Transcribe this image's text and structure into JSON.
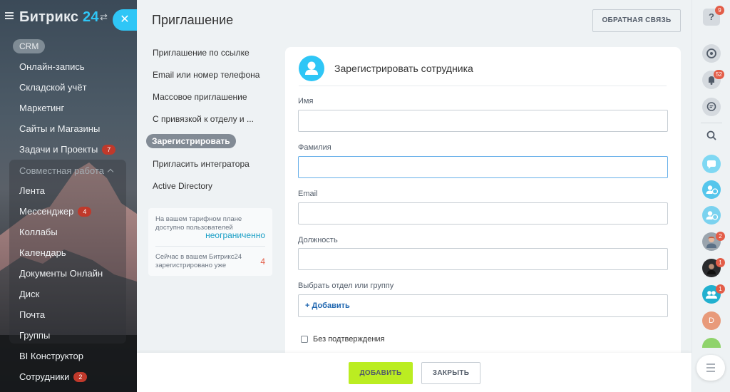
{
  "sidebar": {
    "logo_text": "Битрикс",
    "logo_num": "24",
    "crm_label": "CRM",
    "items": [
      {
        "label": "Онлайн-запись",
        "badge": ""
      },
      {
        "label": "Складской учёт",
        "badge": ""
      },
      {
        "label": "Маркетинг",
        "badge": ""
      },
      {
        "label": "Сайты и Магазины",
        "badge": ""
      },
      {
        "label": "Задачи и Проекты",
        "badge": "7"
      }
    ],
    "group_label": "Совместная работа",
    "group_items": [
      {
        "label": "Лента",
        "badge": ""
      },
      {
        "label": "Мессенджер",
        "badge": "4"
      },
      {
        "label": "Коллабы",
        "badge": ""
      },
      {
        "label": "Календарь",
        "badge": ""
      },
      {
        "label": "Документы Онлайн",
        "badge": ""
      },
      {
        "label": "Диск",
        "badge": ""
      },
      {
        "label": "Почта",
        "badge": ""
      },
      {
        "label": "Группы",
        "badge": ""
      }
    ],
    "bottom_items": [
      {
        "label": "BI Конструктор",
        "badge": ""
      },
      {
        "label": "Сотрудники",
        "badge": "2"
      }
    ],
    "close_symbol": "✕",
    "swap_symbol": "⇄"
  },
  "panel": {
    "title": "Приглашение",
    "feedback_button": "ОБРАТНАЯ СВЯЗЬ",
    "nav": [
      "Приглашение по ссылке",
      "Email или номер телефона",
      "Массовое приглашение",
      "С привязкой к отделу и ...",
      "Зарегистрировать",
      "Пригласить интегратора",
      "Active Directory"
    ],
    "info": {
      "plan_text": "На вашем тарифном плане доступно пользователей",
      "plan_value": "неограниченно",
      "registered_text": "Сейчас в вашем Битрикс24 зарегистрировано уже",
      "registered_value": "4"
    }
  },
  "form": {
    "title": "Зарегистрировать сотрудника",
    "fields": [
      {
        "label": "Имя",
        "value": "",
        "placeholder": ""
      },
      {
        "label": "Фамилия",
        "value": "",
        "placeholder": ""
      },
      {
        "label": "Email",
        "value": "",
        "placeholder": ""
      },
      {
        "label": "Должность",
        "value": "",
        "placeholder": ""
      }
    ],
    "department_label": "Выбрать отдел или группу",
    "add_label": "+ Добавить",
    "checkbox_label": "Без подтверждения",
    "checkbox_checked": false
  },
  "footer": {
    "add_button": "ДОБАВИТЬ",
    "close_button": "ЗАКРЫТЬ"
  },
  "rightbar": {
    "help_symbol": "?",
    "help_badge": "9",
    "notifications_badge": "52",
    "avatar_d_letter": "D",
    "badges": [
      "2",
      "1",
      "1"
    ]
  },
  "colors": {
    "accent_blue": "#2fc6f6",
    "add_button_green": "#bbed21",
    "badge_red": "#c0392b",
    "link_blue": "#2067b0",
    "active_nav": "#828b95",
    "avatar_d": "#e89a7a"
  }
}
